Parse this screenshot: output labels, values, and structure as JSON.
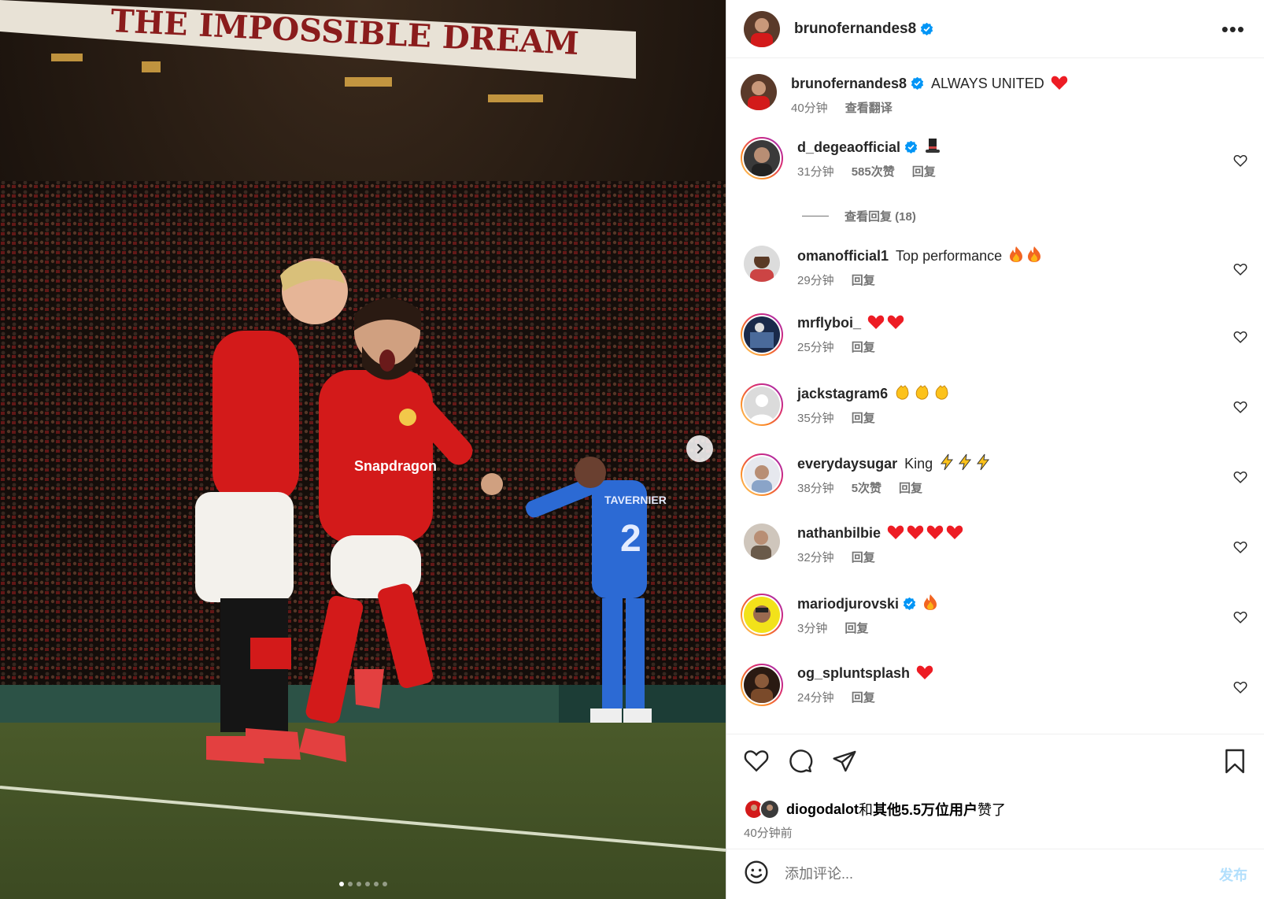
{
  "post": {
    "username": "brunofernandes8",
    "caption": "ALWAYS UNITED",
    "caption_time": "40分钟",
    "see_translation": "查看翻译",
    "banner_text": "THE IMPOSSIBLE DREAM",
    "sponsor": "Snapdragon",
    "opponent_name": "TAVERNIER",
    "opponent_number": "2",
    "carousel_dots": 6,
    "carousel_active": 0
  },
  "comments": [
    {
      "user": "d_degeaofficial",
      "verified": true,
      "text": "",
      "emoji": [
        "tophat"
      ],
      "time": "31分钟",
      "likes": "585次赞",
      "reply": "回复",
      "view_replies": "查看回复 (18)"
    },
    {
      "user": "omanofficial1",
      "verified": false,
      "text": "Top performance",
      "emoji": [
        "fire",
        "fire"
      ],
      "time": "29分钟",
      "likes": "",
      "reply": "回复"
    },
    {
      "user": "mrflyboi_",
      "verified": false,
      "text": "",
      "emoji": [
        "heart",
        "heart"
      ],
      "time": "25分钟",
      "likes": "",
      "reply": "回复"
    },
    {
      "user": "jackstagram6",
      "verified": false,
      "text": "",
      "emoji": [
        "clap",
        "clap",
        "clap"
      ],
      "time": "35分钟",
      "likes": "",
      "reply": "回复"
    },
    {
      "user": "everydaysugar",
      "verified": false,
      "text": "King",
      "emoji": [
        "bolt",
        "bolt",
        "bolt"
      ],
      "time": "38分钟",
      "likes": "5次赞",
      "reply": "回复"
    },
    {
      "user": "nathanbilbie",
      "verified": false,
      "text": "",
      "emoji": [
        "heart",
        "heart",
        "heart",
        "heart"
      ],
      "time": "32分钟",
      "likes": "",
      "reply": "回复"
    },
    {
      "user": "mariodjurovski",
      "verified": true,
      "text": "",
      "emoji": [
        "fire"
      ],
      "time": "3分钟",
      "likes": "",
      "reply": "回复"
    },
    {
      "user": "og_spluntsplash",
      "verified": false,
      "text": "",
      "emoji": [
        "heart"
      ],
      "time": "24分钟",
      "likes": "",
      "reply": "回复"
    }
  ],
  "likes": {
    "user": "diogodalot",
    "connector": "和",
    "others": "其他5.5万位用户",
    "suffix": "赞了"
  },
  "posted_ago": "40分钟前",
  "add_comment": {
    "placeholder": "添加评论...",
    "post_label": "发布"
  },
  "colors": {
    "verified": "#0095f6",
    "heart": "#ed1c24",
    "post_button": "#b2dffc"
  }
}
